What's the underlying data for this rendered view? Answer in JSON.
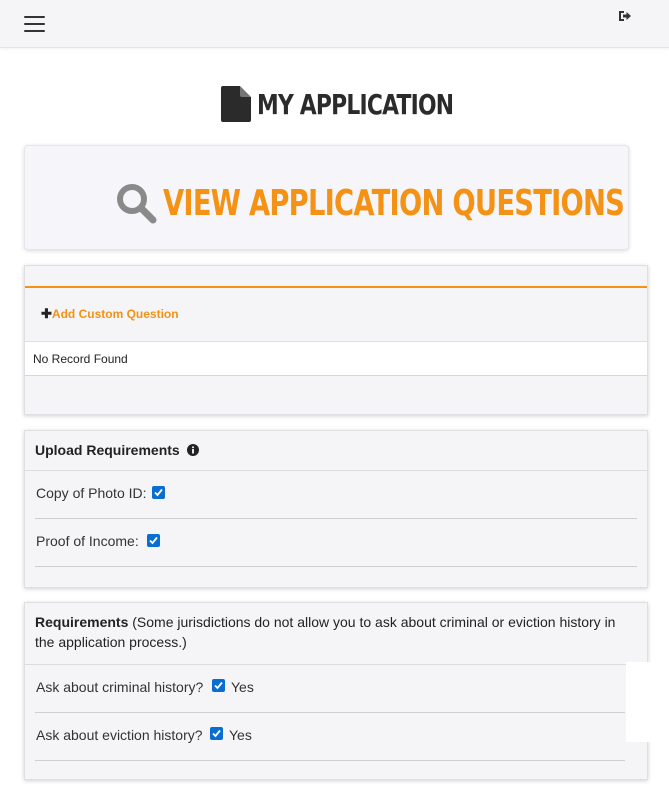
{
  "topbar": {
    "menu_icon": "hamburger-menu-icon",
    "logout_icon": "sign-out-icon"
  },
  "page": {
    "title": "MY APPLICATION",
    "title_icon": "file-document-icon"
  },
  "view_card": {
    "label": "VIEW APPLICATION QUESTIONS",
    "icon": "search-icon",
    "accent": "#f39214"
  },
  "custom_questions": {
    "add_label": "Add Custom Question",
    "empty_text": "No Record Found"
  },
  "upload_requirements": {
    "heading": "Upload Requirements",
    "items": [
      {
        "label": "Copy of Photo ID:",
        "checked": true
      },
      {
        "label": "Proof of Income:",
        "checked": true
      }
    ]
  },
  "requirements": {
    "heading": "Requirements",
    "note": " (Some jurisdictions do not allow you to ask about criminal or eviction history in the application process.)",
    "items": [
      {
        "label": "Ask about criminal history?",
        "checked": true,
        "value": "Yes"
      },
      {
        "label": "Ask about eviction history?",
        "checked": true,
        "value": "Yes"
      }
    ]
  },
  "colors": {
    "accent": "#f39214",
    "checkbox": "#0a6ed1",
    "panel_bg": "#f5f5f8"
  }
}
